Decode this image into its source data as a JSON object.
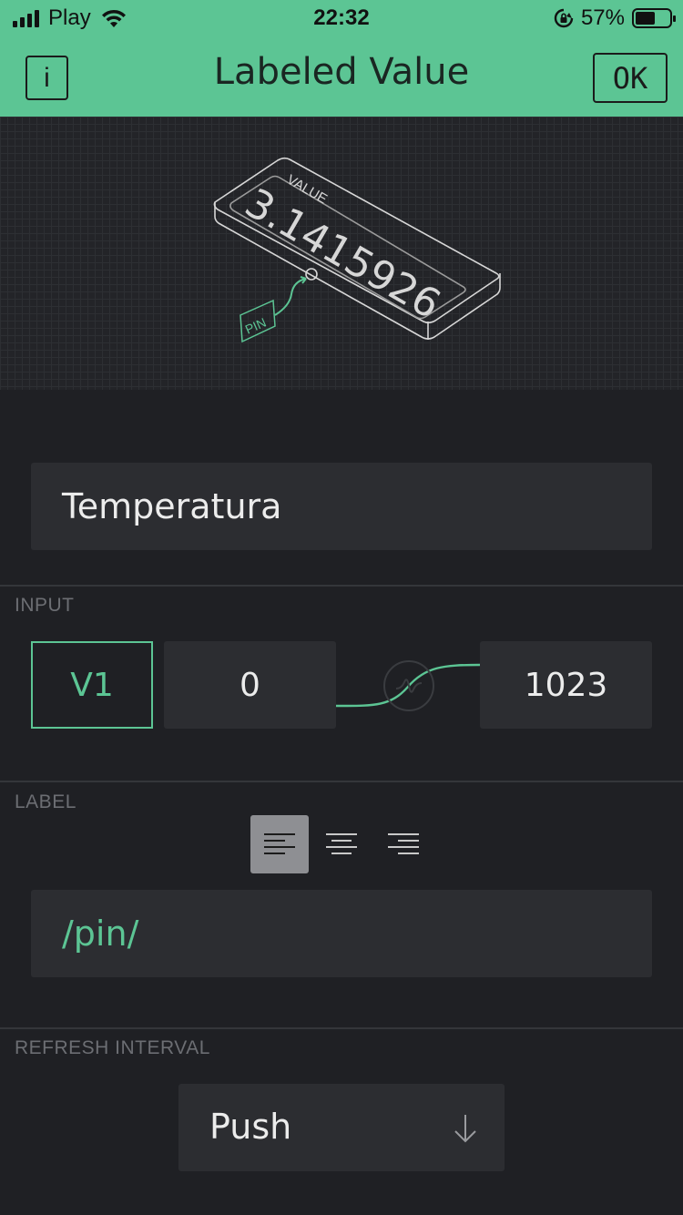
{
  "status_bar": {
    "carrier": "Play",
    "time": "22:32",
    "battery_percent": "57%",
    "battery_level": 0.57,
    "icons": [
      "signal-icon",
      "wifi-icon",
      "rotation-lock-icon",
      "battery-icon"
    ]
  },
  "header": {
    "info_label": "i",
    "title": "Labeled Value",
    "ok_label": "OK"
  },
  "illustration": {
    "display_caption": "VALUE",
    "display_value": "3.1415926",
    "pin_tag": "PIN"
  },
  "form": {
    "title_value": "Temperatura",
    "input": {
      "section_label": "INPUT",
      "pin": "V1",
      "min": "0",
      "max": "1023",
      "curve_icon": "wave-icon"
    },
    "label": {
      "section_label": "LABEL",
      "alignment_options": [
        "align-left",
        "align-center",
        "align-right"
      ],
      "selected_alignment": "align-left",
      "value": "/pin/"
    },
    "refresh": {
      "section_label": "REFRESH INTERVAL",
      "value": "Push",
      "arrow_icon": "arrow-down-icon"
    }
  },
  "colors": {
    "accent": "#5cc594",
    "background": "#1f2024",
    "field": "#2c2d31",
    "divider": "#34363a",
    "section_label": "#6c6e73"
  }
}
